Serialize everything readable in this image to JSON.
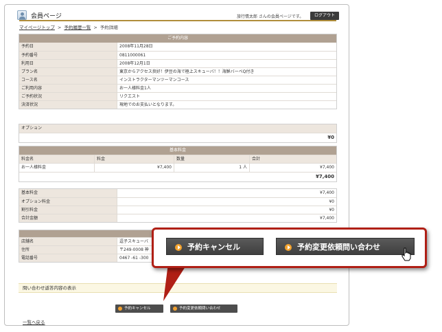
{
  "header": {
    "title": "会員ページ",
    "user_text": "旅行情太郎 さんの会員ページです。",
    "logout_label": "ログアウト"
  },
  "breadcrumb": {
    "items": [
      "マイページトップ",
      "予約履歴一覧",
      "予約詳細"
    ],
    "separator": ">"
  },
  "reservation": {
    "heading": "ご予約内容",
    "rows": [
      {
        "label": "予約日",
        "value": "2008年11月28日"
      },
      {
        "label": "予約番号",
        "value": "0811000061"
      },
      {
        "label": "利用日",
        "value": "2008年12月1日"
      },
      {
        "label": "プラン名",
        "value": "東京からアクセス良好！伊豆の海で極上スキューバ！！海鮮バーベQ付き"
      },
      {
        "label": "コース名",
        "value": "インストラクターマンツーマンコース"
      },
      {
        "label": "ご利用内容",
        "value": "お一人様料金1人"
      },
      {
        "label": "ご予約状況",
        "value": "リクエスト"
      },
      {
        "label": "決済状況",
        "value": "現地でのお支払いとなります。"
      }
    ]
  },
  "options": {
    "label": "オプション",
    "total": "¥0"
  },
  "base_fee": {
    "heading": "基本料金",
    "columns": [
      "料金名",
      "料金",
      "数量",
      "合計"
    ],
    "rows": [
      {
        "name": "お一人様料金",
        "price": "¥7,400",
        "qty": "1 人",
        "total": "¥7,400"
      }
    ],
    "total": "¥7,400"
  },
  "summary": {
    "rows": [
      {
        "label": "基本料金",
        "value": "¥7,400"
      },
      {
        "label": "オプション料金",
        "value": "¥0"
      },
      {
        "label": "割引料金",
        "value": "¥0"
      },
      {
        "label": "合計金額",
        "value": "¥7,400"
      }
    ]
  },
  "store": {
    "rows": [
      {
        "label": "店舗名",
        "value": "逗子スキューバ"
      },
      {
        "label": "住所",
        "value": "〒249-0008 神"
      },
      {
        "label": "電話番号",
        "value": "0467 -61 -300"
      }
    ]
  },
  "inquiry": {
    "label": "問い合わせ返答内容の表示"
  },
  "actions": {
    "cancel_label": "予約キャンセル",
    "change_label": "予約変更依頼問い合わせ"
  },
  "back_label": "一覧へ戻る",
  "colors": {
    "accent_red": "#b01f15",
    "section_header": "#b0a192",
    "label_bg": "#ede6de",
    "button_dark": "#4d4d4d",
    "button_dot": "#f3a22d",
    "header_rule": "#b08d3a"
  },
  "icons": {
    "header": "member-icon",
    "button": "play-circle-icon",
    "cursor": "hand-pointer-icon"
  }
}
